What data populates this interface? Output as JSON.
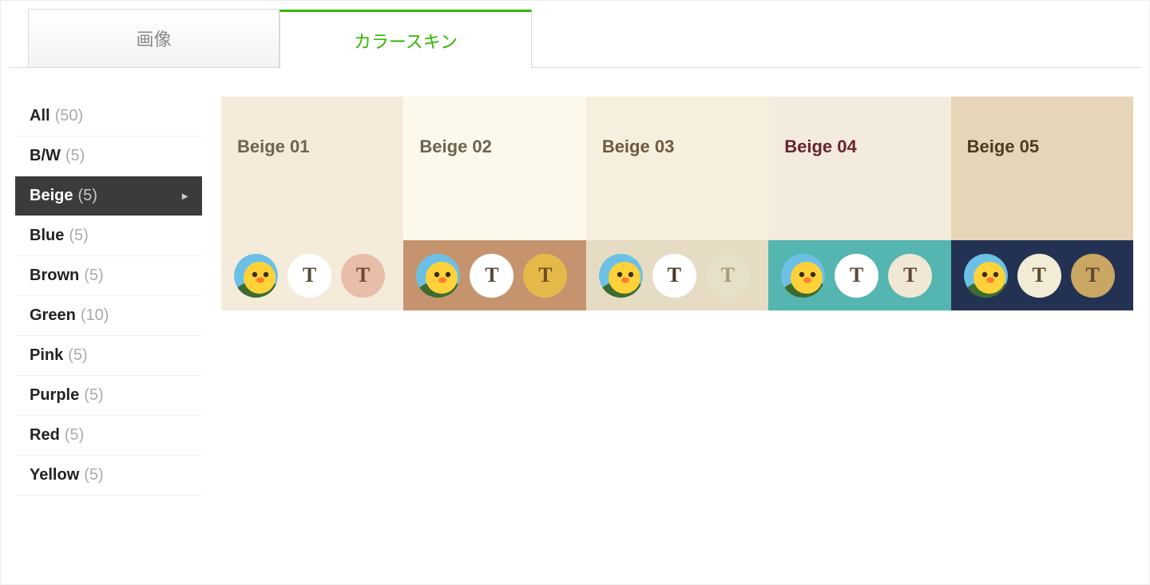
{
  "tabs": [
    {
      "id": "image",
      "label": "画像",
      "active": false
    },
    {
      "id": "color",
      "label": "カラースキン",
      "active": true
    }
  ],
  "categories": [
    {
      "name": "All",
      "count": "(50)",
      "active": false
    },
    {
      "name": "B/W",
      "count": "(5)",
      "active": false
    },
    {
      "name": "Beige",
      "count": "(5)",
      "active": true
    },
    {
      "name": "Blue",
      "count": "(5)",
      "active": false
    },
    {
      "name": "Brown",
      "count": "(5)",
      "active": false
    },
    {
      "name": "Green",
      "count": "(10)",
      "active": false
    },
    {
      "name": "Pink",
      "count": "(5)",
      "active": false
    },
    {
      "name": "Purple",
      "count": "(5)",
      "active": false
    },
    {
      "name": "Red",
      "count": "(5)",
      "active": false
    },
    {
      "name": "Yellow",
      "count": "(5)",
      "active": false
    }
  ],
  "swatches": [
    {
      "title": "Beige 01",
      "topBg": "#f4ebdb",
      "titleColor": "#6e6350",
      "bottomBg": "#f4ebdb",
      "t1": {
        "bg": "#ffffff",
        "fg": "#5a4a37"
      },
      "t2": {
        "bg": "#e8bea8",
        "fg": "#6e4a34"
      }
    },
    {
      "title": "Beige 02",
      "topBg": "#fcf9ec",
      "titleColor": "#6e6350",
      "bottomBg": "#c5946f",
      "t1": {
        "bg": "#ffffff",
        "fg": "#5a4a37"
      },
      "t2": {
        "bg": "#e4b94a",
        "fg": "#6a4f1f"
      }
    },
    {
      "title": "Beige 03",
      "topBg": "#f6efdd",
      "titleColor": "#6d5a41",
      "bottomBg": "#e6dcc4",
      "t1": {
        "bg": "#ffffff",
        "fg": "#4b3a24"
      },
      "t2": {
        "bg": "#e7e0c8",
        "fg": "#a99a78"
      }
    },
    {
      "title": "Beige 04",
      "topBg": "#f3ecde",
      "titleColor": "#69242c",
      "bottomBg": "#55b5b0",
      "t1": {
        "bg": "#ffffff",
        "fg": "#5b4a36"
      },
      "t2": {
        "bg": "#f0e8d4",
        "fg": "#5b4a36"
      }
    },
    {
      "title": "Beige 05",
      "topBg": "#e6d6b7",
      "titleColor": "#4c3b1f",
      "bottomBg": "#233152",
      "t1": {
        "bg": "#f2ebd6",
        "fg": "#5b4a36"
      },
      "t2": {
        "bg": "#c9a661",
        "fg": "#5b4a36"
      }
    }
  ]
}
